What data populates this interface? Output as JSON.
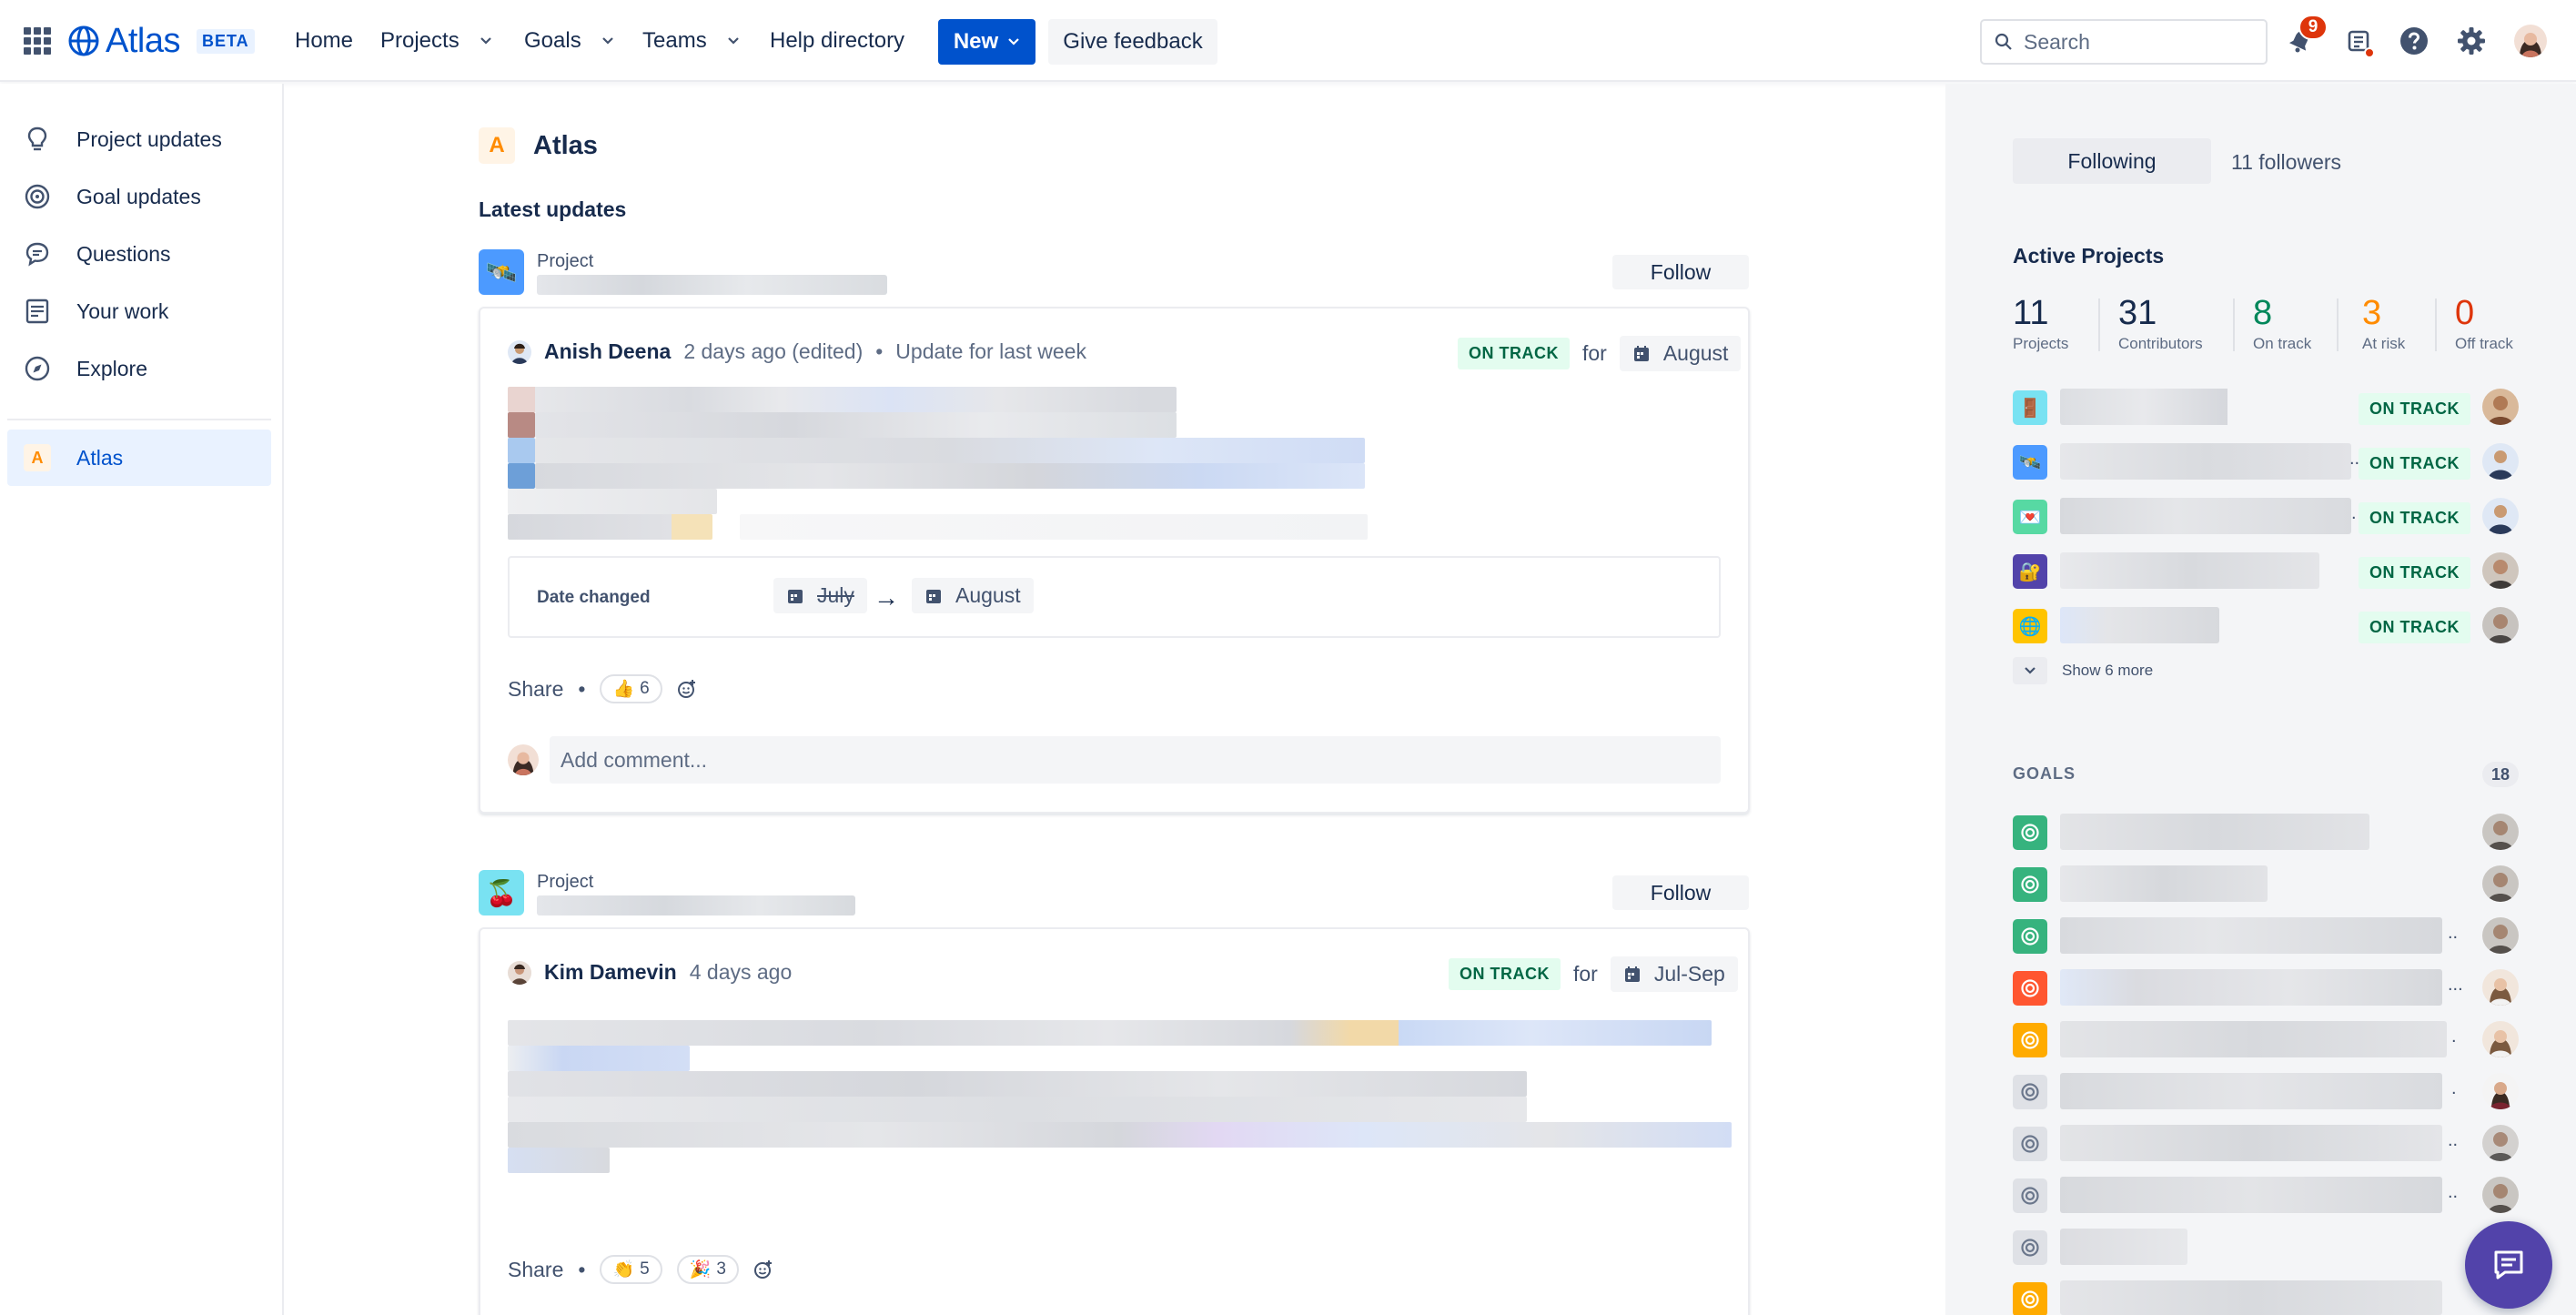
{
  "header": {
    "app_name": "Atlas",
    "beta_label": "BETA",
    "nav": {
      "home": "Home",
      "projects": "Projects",
      "goals": "Goals",
      "teams": "Teams",
      "help_directory": "Help directory"
    },
    "new_button": "New",
    "feedback_button": "Give feedback",
    "search_placeholder": "Search",
    "notification_count": "9",
    "icons": [
      "app-switcher-icon",
      "bell-icon",
      "whats-new-icon",
      "help-icon",
      "settings-icon"
    ],
    "brand_color": "#0052cc"
  },
  "sidebar": {
    "items": [
      {
        "label": "Project updates",
        "icon": "lightbulb-icon"
      },
      {
        "label": "Goal updates",
        "icon": "target-icon"
      },
      {
        "label": "Questions",
        "icon": "comment-icon"
      },
      {
        "label": "Your work",
        "icon": "document-icon"
      },
      {
        "label": "Explore",
        "icon": "compass-icon"
      }
    ],
    "workspace": {
      "label": "Atlas",
      "initial": "A"
    }
  },
  "main": {
    "title": "Atlas",
    "title_initial": "A",
    "section_title": "Latest updates",
    "updates": [
      {
        "type_label": "Project",
        "follow_label": "Follow",
        "author": "Anish Deena",
        "meta": "2 days ago (edited)",
        "subtitle": "Update for last week",
        "status": "ON TRACK",
        "for_label": "for",
        "target": "August",
        "date_changed": {
          "label": "Date changed",
          "from": "July",
          "to": "August"
        },
        "share_label": "Share",
        "reactions": [
          {
            "emoji": "👍",
            "count": "6"
          }
        ],
        "comment_placeholder": "Add comment..."
      },
      {
        "type_label": "Project",
        "follow_label": "Follow",
        "author": "Kim Damevin",
        "meta": "4 days ago",
        "status": "ON TRACK",
        "for_label": "for",
        "target": "Jul-Sep",
        "share_label": "Share",
        "reactions": [
          {
            "emoji": "👏",
            "count": "5"
          },
          {
            "emoji": "🎉",
            "count": "3"
          }
        ]
      }
    ]
  },
  "right_panel": {
    "following_button": "Following",
    "followers": "11 followers",
    "active_projects_title": "Active Projects",
    "stats": [
      {
        "value": "11",
        "label": "Projects",
        "color": "#172b4d"
      },
      {
        "value": "31",
        "label": "Contributors",
        "color": "#172b4d"
      },
      {
        "value": "8",
        "label": "On track",
        "color": "#00875a"
      },
      {
        "value": "3",
        "label": "At risk",
        "color": "#ff8b00"
      },
      {
        "value": "0",
        "label": "Off track",
        "color": "#de350b"
      }
    ],
    "active_projects": [
      {
        "status": "ON TRACK"
      },
      {
        "status": "ON TRACK"
      },
      {
        "status": "ON TRACK"
      },
      {
        "status": "ON TRACK"
      },
      {
        "status": "ON TRACK"
      }
    ],
    "show_more": "Show 6 more",
    "goals_title": "GOALS",
    "goals_count": "18"
  }
}
